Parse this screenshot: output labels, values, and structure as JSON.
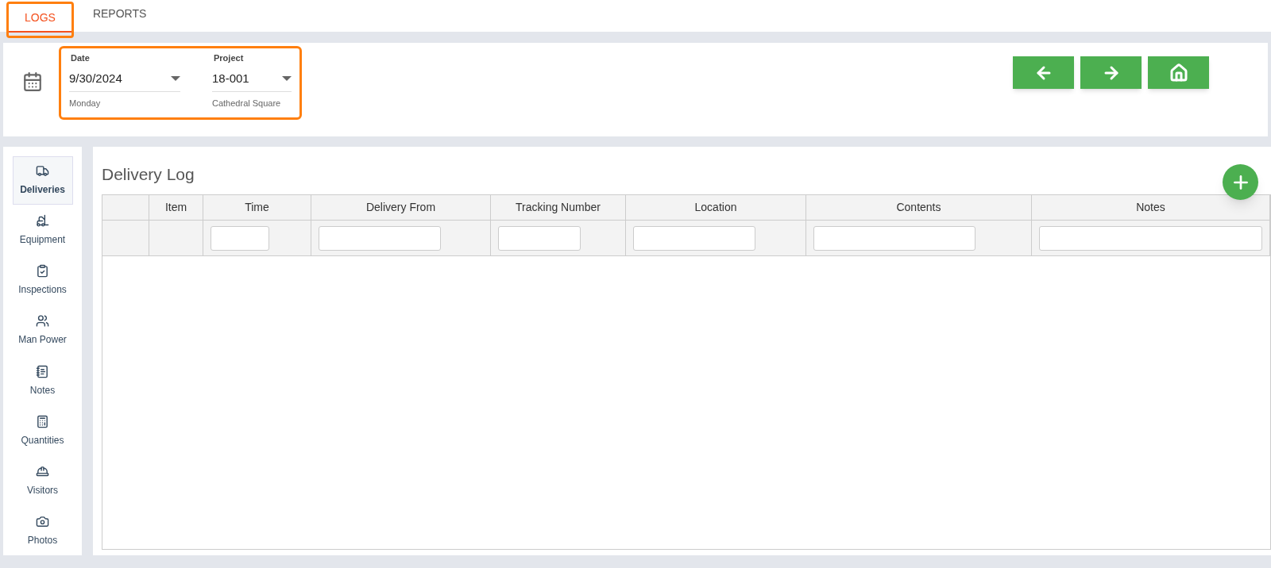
{
  "tabs": [
    {
      "label": "LOGS",
      "selected": true,
      "highlighted": true
    },
    {
      "label": "REPORTS",
      "selected": false,
      "highlighted": false
    }
  ],
  "filters": [
    {
      "label": "Date",
      "value": "9/30/2024",
      "hint": "Monday"
    },
    {
      "label": "Project",
      "value": "18-001",
      "hint": "Cathedral Square"
    }
  ],
  "sidebar": {
    "items": [
      {
        "label": "Deliveries",
        "selected": true
      },
      {
        "label": "Equipment",
        "selected": false
      },
      {
        "label": "Inspections",
        "selected": false
      },
      {
        "label": "Man Power",
        "selected": false
      },
      {
        "label": "Notes",
        "selected": false
      },
      {
        "label": "Quantities",
        "selected": false
      },
      {
        "label": "Visitors",
        "selected": false
      },
      {
        "label": "Photos",
        "selected": false
      }
    ]
  },
  "page_title": "Delivery Log",
  "table": {
    "columns": [
      {
        "filter": false
      },
      {
        "label": "Item",
        "filter": false
      },
      {
        "label": "Time",
        "filter": true
      },
      {
        "label": "Delivery From",
        "filter": true
      },
      {
        "label": "Tracking Number",
        "filter": true
      },
      {
        "label": "Location",
        "filter": true
      },
      {
        "label": "Contents",
        "filter": true
      },
      {
        "label": "Notes",
        "filter": true
      }
    ]
  }
}
